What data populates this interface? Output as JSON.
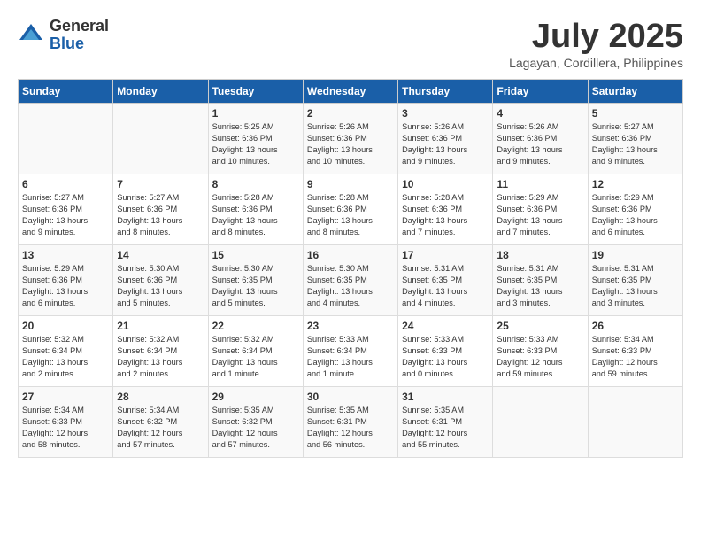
{
  "header": {
    "logo_general": "General",
    "logo_blue": "Blue",
    "month": "July 2025",
    "location": "Lagayan, Cordillera, Philippines"
  },
  "weekdays": [
    "Sunday",
    "Monday",
    "Tuesday",
    "Wednesday",
    "Thursday",
    "Friday",
    "Saturday"
  ],
  "weeks": [
    [
      {
        "day": "",
        "content": ""
      },
      {
        "day": "",
        "content": ""
      },
      {
        "day": "1",
        "content": "Sunrise: 5:25 AM\nSunset: 6:36 PM\nDaylight: 13 hours\nand 10 minutes."
      },
      {
        "day": "2",
        "content": "Sunrise: 5:26 AM\nSunset: 6:36 PM\nDaylight: 13 hours\nand 10 minutes."
      },
      {
        "day": "3",
        "content": "Sunrise: 5:26 AM\nSunset: 6:36 PM\nDaylight: 13 hours\nand 9 minutes."
      },
      {
        "day": "4",
        "content": "Sunrise: 5:26 AM\nSunset: 6:36 PM\nDaylight: 13 hours\nand 9 minutes."
      },
      {
        "day": "5",
        "content": "Sunrise: 5:27 AM\nSunset: 6:36 PM\nDaylight: 13 hours\nand 9 minutes."
      }
    ],
    [
      {
        "day": "6",
        "content": "Sunrise: 5:27 AM\nSunset: 6:36 PM\nDaylight: 13 hours\nand 9 minutes."
      },
      {
        "day": "7",
        "content": "Sunrise: 5:27 AM\nSunset: 6:36 PM\nDaylight: 13 hours\nand 8 minutes."
      },
      {
        "day": "8",
        "content": "Sunrise: 5:28 AM\nSunset: 6:36 PM\nDaylight: 13 hours\nand 8 minutes."
      },
      {
        "day": "9",
        "content": "Sunrise: 5:28 AM\nSunset: 6:36 PM\nDaylight: 13 hours\nand 8 minutes."
      },
      {
        "day": "10",
        "content": "Sunrise: 5:28 AM\nSunset: 6:36 PM\nDaylight: 13 hours\nand 7 minutes."
      },
      {
        "day": "11",
        "content": "Sunrise: 5:29 AM\nSunset: 6:36 PM\nDaylight: 13 hours\nand 7 minutes."
      },
      {
        "day": "12",
        "content": "Sunrise: 5:29 AM\nSunset: 6:36 PM\nDaylight: 13 hours\nand 6 minutes."
      }
    ],
    [
      {
        "day": "13",
        "content": "Sunrise: 5:29 AM\nSunset: 6:36 PM\nDaylight: 13 hours\nand 6 minutes."
      },
      {
        "day": "14",
        "content": "Sunrise: 5:30 AM\nSunset: 6:36 PM\nDaylight: 13 hours\nand 5 minutes."
      },
      {
        "day": "15",
        "content": "Sunrise: 5:30 AM\nSunset: 6:35 PM\nDaylight: 13 hours\nand 5 minutes."
      },
      {
        "day": "16",
        "content": "Sunrise: 5:30 AM\nSunset: 6:35 PM\nDaylight: 13 hours\nand 4 minutes."
      },
      {
        "day": "17",
        "content": "Sunrise: 5:31 AM\nSunset: 6:35 PM\nDaylight: 13 hours\nand 4 minutes."
      },
      {
        "day": "18",
        "content": "Sunrise: 5:31 AM\nSunset: 6:35 PM\nDaylight: 13 hours\nand 3 minutes."
      },
      {
        "day": "19",
        "content": "Sunrise: 5:31 AM\nSunset: 6:35 PM\nDaylight: 13 hours\nand 3 minutes."
      }
    ],
    [
      {
        "day": "20",
        "content": "Sunrise: 5:32 AM\nSunset: 6:34 PM\nDaylight: 13 hours\nand 2 minutes."
      },
      {
        "day": "21",
        "content": "Sunrise: 5:32 AM\nSunset: 6:34 PM\nDaylight: 13 hours\nand 2 minutes."
      },
      {
        "day": "22",
        "content": "Sunrise: 5:32 AM\nSunset: 6:34 PM\nDaylight: 13 hours\nand 1 minute."
      },
      {
        "day": "23",
        "content": "Sunrise: 5:33 AM\nSunset: 6:34 PM\nDaylight: 13 hours\nand 1 minute."
      },
      {
        "day": "24",
        "content": "Sunrise: 5:33 AM\nSunset: 6:33 PM\nDaylight: 13 hours\nand 0 minutes."
      },
      {
        "day": "25",
        "content": "Sunrise: 5:33 AM\nSunset: 6:33 PM\nDaylight: 12 hours\nand 59 minutes."
      },
      {
        "day": "26",
        "content": "Sunrise: 5:34 AM\nSunset: 6:33 PM\nDaylight: 12 hours\nand 59 minutes."
      }
    ],
    [
      {
        "day": "27",
        "content": "Sunrise: 5:34 AM\nSunset: 6:33 PM\nDaylight: 12 hours\nand 58 minutes."
      },
      {
        "day": "28",
        "content": "Sunrise: 5:34 AM\nSunset: 6:32 PM\nDaylight: 12 hours\nand 57 minutes."
      },
      {
        "day": "29",
        "content": "Sunrise: 5:35 AM\nSunset: 6:32 PM\nDaylight: 12 hours\nand 57 minutes."
      },
      {
        "day": "30",
        "content": "Sunrise: 5:35 AM\nSunset: 6:31 PM\nDaylight: 12 hours\nand 56 minutes."
      },
      {
        "day": "31",
        "content": "Sunrise: 5:35 AM\nSunset: 6:31 PM\nDaylight: 12 hours\nand 55 minutes."
      },
      {
        "day": "",
        "content": ""
      },
      {
        "day": "",
        "content": ""
      }
    ]
  ]
}
